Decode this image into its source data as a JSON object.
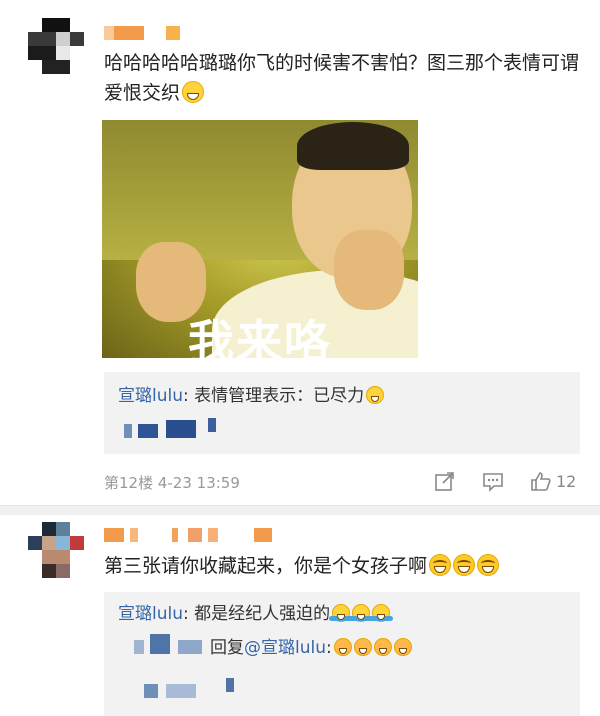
{
  "comments": [
    {
      "text": "哈哈哈哈哈璐璐你飞的时候害不害怕？图三那个表情可谓爱恨交织",
      "emoji": "grin-emoji",
      "image_caption": "我来咯",
      "reply": {
        "user": "宣璐lulu",
        "text": ": 表情管理表示：已尽力",
        "emoji": "smile-emoji"
      },
      "meta": {
        "floor": "第12楼 4-23 13:59",
        "likes": "12"
      }
    },
    {
      "text": "第三张请你收藏起来，你是个女孩子啊",
      "emojis": [
        "laugh-cry-emoji",
        "laugh-cry-emoji",
        "laugh-cry-emoji"
      ],
      "reply": {
        "user": "宣璐lulu",
        "text": ": 都是经纪人强迫的",
        "emojis": [
          "hug-emoji",
          "hug-emoji",
          "hug-emoji"
        ]
      },
      "reply2": {
        "prefix": "回复",
        "mention": "@宣璐lulu",
        "suffix": ":",
        "emojis": [
          "shy-emoji",
          "blush-emoji",
          "blush-emoji",
          "blush-emoji"
        ]
      }
    }
  ],
  "icons": {
    "share": "share-icon",
    "comment": "comment-icon",
    "like": "thumbs-up-icon"
  },
  "colors": {
    "link": "#3466a8",
    "meta": "#999999",
    "reply_bg": "#f2f2f2",
    "name_blur": "#f7a04a"
  }
}
